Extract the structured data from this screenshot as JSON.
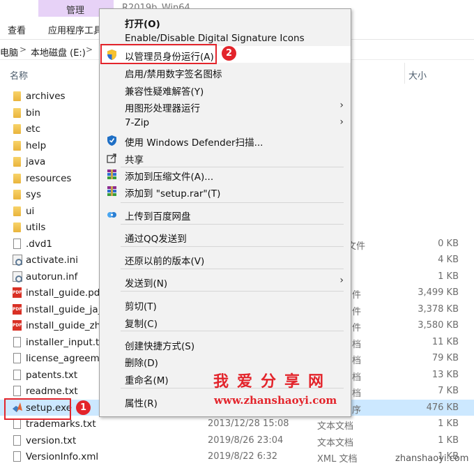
{
  "ribbon": {
    "manage_tab": "管理",
    "window_title": "R2019b_Win64",
    "tabs": [
      "查看",
      "应用程序工具"
    ]
  },
  "address": {
    "crumb1": "电脑",
    "separator": ">",
    "crumb2": "本地磁盘 (E:)"
  },
  "columns": {
    "name": "名称",
    "size": "大小"
  },
  "files": [
    {
      "name": "archives",
      "icon": "folder-icon",
      "date": "",
      "type": "",
      "size": ""
    },
    {
      "name": "bin",
      "icon": "folder-icon",
      "date": "",
      "type": "",
      "size": ""
    },
    {
      "name": "etc",
      "icon": "folder-icon",
      "date": "",
      "type": "",
      "size": ""
    },
    {
      "name": "help",
      "icon": "folder-icon",
      "date": "",
      "type": "",
      "size": ""
    },
    {
      "name": "java",
      "icon": "folder-icon",
      "date": "",
      "type": "",
      "size": ""
    },
    {
      "name": "resources",
      "icon": "folder-icon",
      "date": "",
      "type": "",
      "size": ""
    },
    {
      "name": "sys",
      "icon": "folder-icon",
      "date": "",
      "type": "",
      "size": ""
    },
    {
      "name": "ui",
      "icon": "folder-icon",
      "date": "",
      "type": "",
      "size": ""
    },
    {
      "name": "utils",
      "icon": "folder-icon",
      "date": "",
      "type": "",
      "size": ""
    },
    {
      "name": ".dvd1",
      "icon": "file-icon",
      "date": "",
      "type": "文件",
      "size": "0 KB"
    },
    {
      "name": "activate.ini",
      "icon": "gear-icon",
      "date": "",
      "type": "",
      "size": "4 KB"
    },
    {
      "name": "autorun.inf",
      "icon": "gear-icon",
      "date": "",
      "type": "",
      "size": "1 KB"
    },
    {
      "name": "install_guide.pdf",
      "icon": "pdf-icon",
      "date": "",
      "type": "件",
      "size": "3,499 KB"
    },
    {
      "name": "install_guide_ja_",
      "icon": "pdf-icon",
      "date": "",
      "type": "件",
      "size": "3,378 KB"
    },
    {
      "name": "install_guide_zh_",
      "icon": "pdf-icon",
      "date": "",
      "type": "件",
      "size": "3,580 KB"
    },
    {
      "name": "installer_input.tx",
      "icon": "file-icon",
      "date": "",
      "type": "档",
      "size": "11 KB"
    },
    {
      "name": "license_agreeme",
      "icon": "file-icon",
      "date": "",
      "type": "档",
      "size": "79 KB"
    },
    {
      "name": "patents.txt",
      "icon": "file-icon",
      "date": "",
      "type": "档",
      "size": "13 KB"
    },
    {
      "name": "readme.txt",
      "icon": "file-icon",
      "date": "",
      "type": "档",
      "size": "7 KB"
    },
    {
      "name": "setup.exe",
      "icon": "matlab-icon",
      "date": "",
      "type": "序",
      "size": "476 KB"
    },
    {
      "name": "trademarks.txt",
      "icon": "file-icon",
      "date": "2013/12/28 15:08",
      "type": "文本文档",
      "size": "1 KB"
    },
    {
      "name": "version.txt",
      "icon": "file-icon",
      "date": "2019/8/26 23:04",
      "type": "文本文档",
      "size": "1 KB"
    },
    {
      "name": "VersionInfo.xml",
      "icon": "file-icon",
      "date": "2019/8/22 6:32",
      "type": "XML 文档",
      "size": "1 KB"
    }
  ],
  "menu": {
    "items": [
      {
        "label": "打开(O)",
        "bold": true
      },
      {
        "label": "Enable/Disable Digital Signature Icons"
      },
      {
        "label": "以管理员身份运行(A)",
        "icon": "uac-shield-icon"
      },
      {
        "label": "启用/禁用数字签名图标"
      },
      {
        "label": "兼容性疑难解答(Y)"
      },
      {
        "label": "用图形处理器运行",
        "submenu": true
      },
      {
        "label": "7-Zip",
        "submenu": true
      },
      {
        "label": "使用 Windows Defender扫描...",
        "icon": "defender-icon"
      },
      {
        "label": "共享",
        "icon": "share-icon"
      },
      {
        "label": "添加到压缩文件(A)...",
        "icon": "winrar-icon"
      },
      {
        "label": "添加到 \"setup.rar\"(T)",
        "icon": "winrar-icon"
      },
      {
        "label": "上传到百度网盘",
        "icon": "baidu-netdisk-icon"
      },
      {
        "label": "通过QQ发送到"
      },
      {
        "label": "还原以前的版本(V)"
      },
      {
        "label": "发送到(N)",
        "submenu": true
      },
      {
        "label": "剪切(T)"
      },
      {
        "label": "复制(C)"
      },
      {
        "label": "创建快捷方式(S)"
      },
      {
        "label": "删除(D)"
      },
      {
        "label": "重命名(M)"
      },
      {
        "label": "属性(R)"
      }
    ],
    "submenu_arrow": "›"
  },
  "annotations": {
    "badge1": "1",
    "badge2": "2",
    "highlight_color": "#e3242b"
  },
  "watermark": {
    "chinese": "我爱分享网",
    "url": "www.zhanshaoyi.com",
    "corner": "zhanshaoyi.com"
  },
  "colors": {
    "manage_tab": "#e7d2f7",
    "selection": "#cce8ff",
    "menu_bg": "#f2f2f2"
  }
}
